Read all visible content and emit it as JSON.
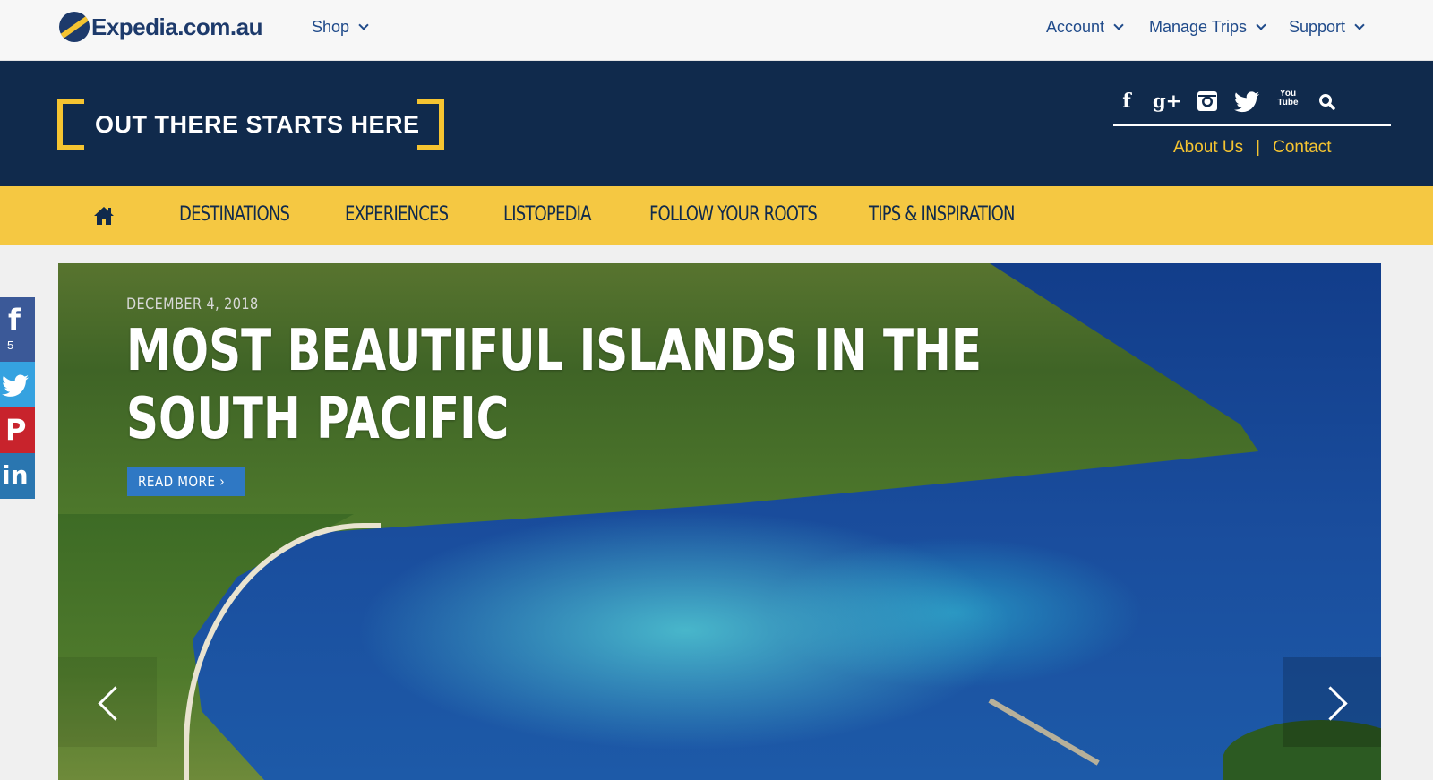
{
  "topbar": {
    "brand": "Expedia.com.au",
    "shop": "Shop",
    "account": "Account",
    "manage_trips": "Manage Trips",
    "support": "Support"
  },
  "header": {
    "logo_text": "OUT THERE STARTS HERE",
    "social_icons": [
      "facebook-icon",
      "google-plus-icon",
      "instagram-icon",
      "twitter-icon",
      "youtube-icon",
      "search-icon"
    ],
    "google_plus_glyph": "g+",
    "youtube_glyph": "You Tube",
    "about": "About Us",
    "separator": "|",
    "contact": "Contact"
  },
  "nav": {
    "items": [
      {
        "label": "DESTINATIONS"
      },
      {
        "label": "EXPERIENCES"
      },
      {
        "label": "LISTOPEDIA"
      },
      {
        "label": "FOLLOW YOUR ROOTS"
      },
      {
        "label": "TIPS & INSPIRATION"
      }
    ]
  },
  "hero": {
    "date": "DECEMBER 4, 2018",
    "title": "MOST BEAUTIFUL ISLANDS IN THE SOUTH PACIFIC",
    "cta": "READ MORE ›"
  },
  "share": {
    "facebook_glyph": "f",
    "facebook_count": "5",
    "pinterest_glyph": "P",
    "linkedin_glyph": "in"
  },
  "colors": {
    "navy": "#102a4c",
    "yellow": "#f5c842",
    "link_blue": "#1f4a8a",
    "cta_blue": "#2f78c4"
  }
}
